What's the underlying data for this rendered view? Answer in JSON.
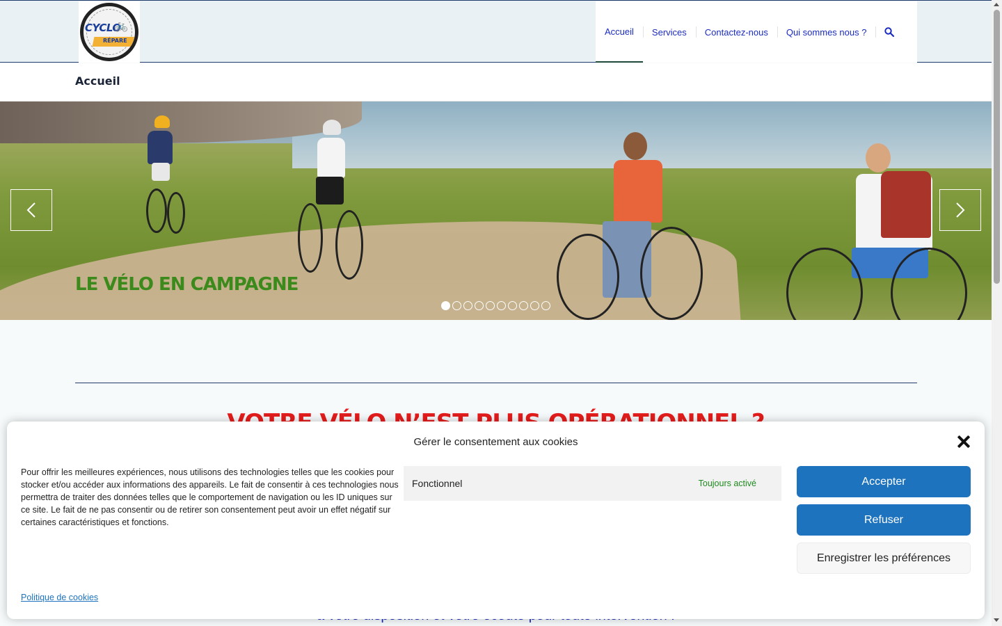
{
  "header": {
    "logo": {
      "line1": "CYCLO",
      "line2": "RÉPARE"
    },
    "nav": [
      {
        "label": "Accueil",
        "active": true
      },
      {
        "label": "Services",
        "active": false
      },
      {
        "label": "Contactez-nous",
        "active": false
      },
      {
        "label": "Qui sommes nous ?",
        "active": false
      }
    ],
    "search_icon": "search-icon"
  },
  "page": {
    "title": "Accueil"
  },
  "slider": {
    "caption": "LE VÉLO EN CAMPAGNE",
    "slide_count": 10,
    "active_slide": 1,
    "prev_icon": "chevron-left-icon",
    "next_icon": "chevron-right-icon"
  },
  "content": {
    "heading": "VOTRE VÉLO N’EST PLUS OPÉRATIONNEL ?",
    "subline": "à votre disposition et votre écoute pour toute intervention !"
  },
  "cookie": {
    "title": "Gérer le consentement aux cookies",
    "text": "Pour offrir les meilleures expériences, nous utilisons des technologies telles que les cookies pour stocker et/ou accéder aux informations des appareils. Le fait de consentir à ces technologies nous permettra de traiter des données telles que le comportement de navigation ou les ID uniques sur ce site. Le fait de ne pas consentir ou de retirer son consentement peut avoir un effet négatif sur certaines caractéristiques et fonctions.",
    "category": {
      "name": "Fonctionnel",
      "status": "Toujours activé"
    },
    "accept": "Accepter",
    "refuse": "Refuser",
    "save": "Enregistrer les préférences",
    "policy": "Politique de cookies"
  },
  "colors": {
    "nav_link": "#1a2bbf",
    "heading_red": "#e51c1c",
    "caption_green": "#3c8a1c",
    "button_blue": "#1e73be",
    "status_green": "#1f8a1f"
  }
}
